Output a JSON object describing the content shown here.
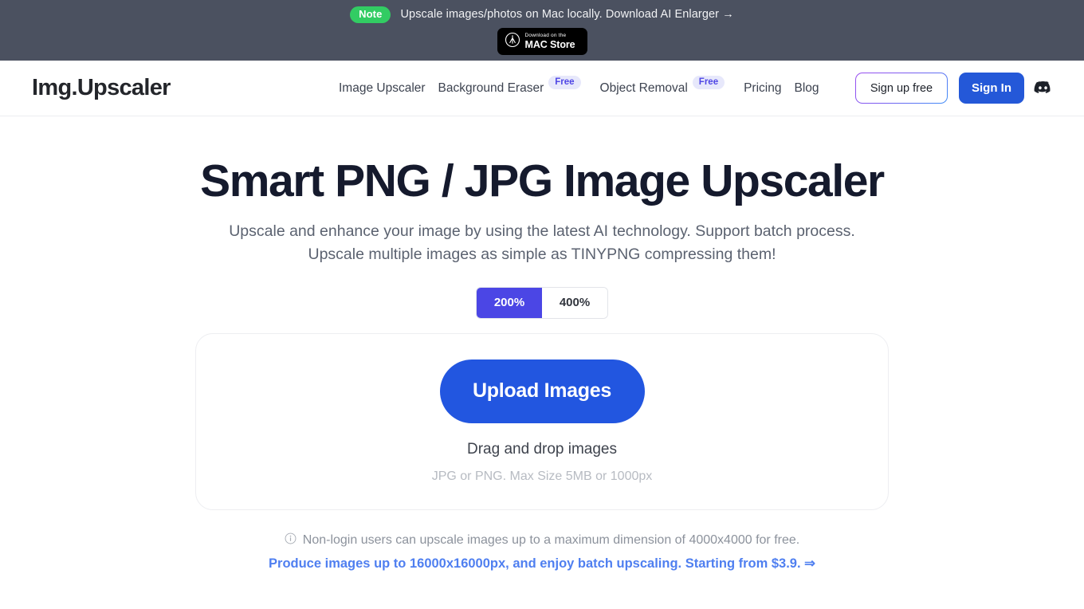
{
  "banner": {
    "badge": "Note",
    "text": "Upscale images/photos on Mac locally. Download AI Enlarger →",
    "store_badge": {
      "small": "Download on the",
      "large": "MAC Store",
      "icon": "apple-logo-icon"
    },
    "background_color": "#4b5160",
    "badge_color": "#32cc63"
  },
  "header": {
    "logo": "Img.Upscaler",
    "nav": [
      {
        "label": "Image Upscaler",
        "badge": null
      },
      {
        "label": "Background Eraser",
        "badge": "Free"
      },
      {
        "label": "Object Removal",
        "badge": "Free"
      },
      {
        "label": "Pricing",
        "badge": null
      },
      {
        "label": "Blog",
        "badge": null
      }
    ],
    "signup_label": "Sign up free",
    "signin_label": "Sign In",
    "discord_icon": "discord-icon",
    "signin_color": "#2458d8",
    "free_badge_color": "#4f46e5"
  },
  "hero": {
    "title": "Smart PNG / JPG Image Upscaler",
    "subtitle": "Upscale and enhance your image by using the latest AI technology. Support batch process. Upscale multiple images as simple as TINYPNG compressing them!"
  },
  "scale": {
    "options": [
      "200%",
      "400%"
    ],
    "selected": "200%",
    "active_color": "#4b46e5"
  },
  "upload": {
    "button_label": "Upload Images",
    "drag_text": "Drag and drop images",
    "hint_text": "JPG or PNG. Max Size 5MB or 1000px",
    "button_color": "#2256e0"
  },
  "notice": {
    "icon": "info-icon",
    "line1": "Non-login users can upscale images up to a maximum dimension of 4000x4000 for free.",
    "line2": "Produce images up to 16000x16000px, and enjoy batch upscaling. Starting from $3.9. ⇒",
    "link_color": "#4f7ff0"
  }
}
